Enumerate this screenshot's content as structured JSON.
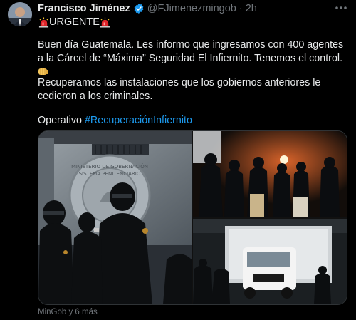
{
  "tweet": {
    "author_name": "Francisco Jiménez",
    "handle": "@FJimenezmingob",
    "separator": "·",
    "time": "2h",
    "urgent_label": "URGENTE",
    "paragraph1": "Buen día Guatemala. Les informo que ingresamos con 400 agentes a la Cárcel de “Máxima” Seguridad El Infiernito. Tenemos el control.",
    "paragraph2": "Recuperamos las instalaciones que los gobiernos anteriores le cedieron a los criminales.",
    "paragraph3_prefix": "Operativo ",
    "hashtag": "#RecuperaciónInfiernito",
    "media_source": "MinGob y 6 más"
  },
  "photo_text": {
    "sign_line1": "MINISTERIO DE GOBERNACIÓN",
    "sign_line2": "SISTEMA PENITENCIARIO"
  },
  "icons": {
    "verified": "verified-badge-icon",
    "siren": "police-siren-icon",
    "fist": "oncoming-fist-icon",
    "more": "more-options-icon"
  },
  "colors": {
    "background": "#000000",
    "text": "#e7e9ea",
    "muted": "#71767b",
    "link": "#1d9bf0",
    "verified": "#1d9bf0"
  }
}
